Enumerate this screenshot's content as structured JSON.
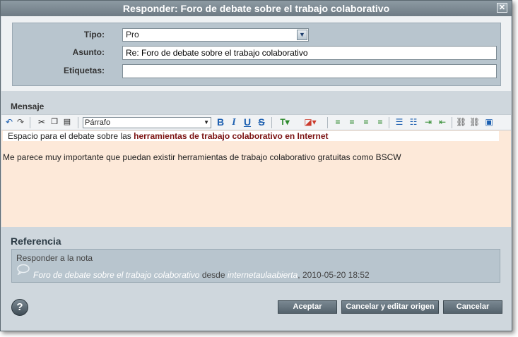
{
  "dialog": {
    "title": "Responder: Foro de debate sobre el trabajo colaborativo",
    "close_label": "✕"
  },
  "form": {
    "tipo_label": "Tipo:",
    "tipo_value": "Pro",
    "asunto_label": "Asunto:",
    "asunto_value": "Re: Foro de debate sobre el trabajo colaborativo",
    "etiquetas_label": "Etiquetas:",
    "etiquetas_value": ""
  },
  "mensaje": {
    "label": "Mensaje",
    "paragraph_format": "Párrafo",
    "line1_prefix": "Espacio para el debate sobre las ",
    "line1_highlight": "herramientas de trabajo colaborativo en Internet",
    "line2": "Me parece muy importante que puedan existir herramientas de trabajo colaborativo gratuitas como BSCW"
  },
  "toolbar_icons": [
    "undo-icon",
    "redo-icon",
    "cut-icon",
    "copy-icon",
    "paste-icon",
    "bold-icon",
    "italic-icon",
    "underline-icon",
    "strikethrough-icon",
    "text-color-icon",
    "highlight-color-icon",
    "align-left-icon",
    "align-center-icon",
    "align-right-icon",
    "justify-icon",
    "numbered-list-icon",
    "bullet-list-icon",
    "indent-icon",
    "outdent-icon",
    "link-icon",
    "unlink-icon",
    "image-icon"
  ],
  "referencia": {
    "title": "Referencia",
    "subtitle": "Responder a la nota",
    "note_title": "Foro de debate sobre el trabajo colaborativo",
    "desde": "desde",
    "origin": "internetaulaabierta",
    "date": ", 2010-05-20 18:52"
  },
  "footer": {
    "help": "?",
    "aceptar": "Aceptar",
    "cancelar_editar": "Cancelar y editar origen",
    "cancelar": "Cancelar"
  },
  "colors": {
    "titlebar": "#7c8a93",
    "panel": "#b8c5ce",
    "editor_bg": "#fde9d9",
    "highlight_text": "#7b1212"
  }
}
